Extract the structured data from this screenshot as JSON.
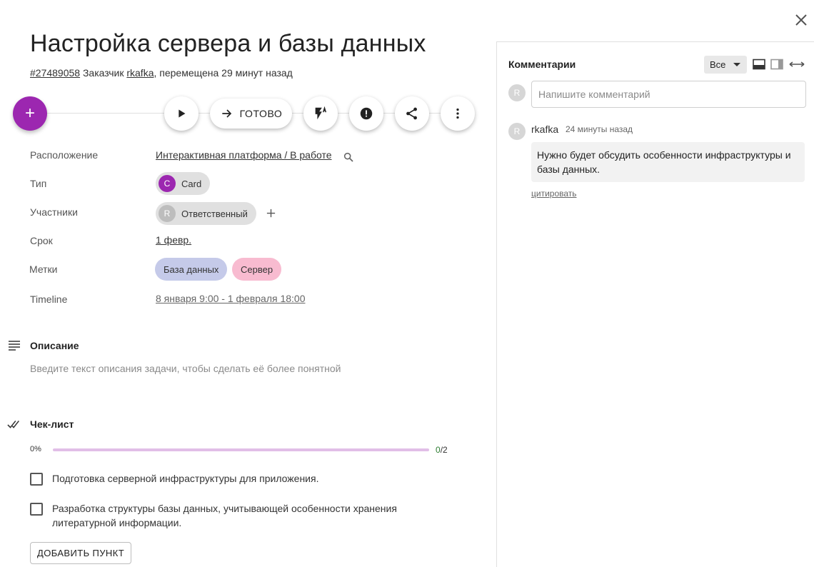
{
  "task": {
    "title": "Настройка сервера и базы данных",
    "id": "#27489058",
    "customer_prefix": "Заказчик",
    "customer": "rkafka",
    "moved_text": ", перемещена 29 минут назад"
  },
  "toolbar": {
    "add_label": "+",
    "done_label": "ГОТОВО"
  },
  "fields": {
    "location_label": "Расположение",
    "location_value": "Интерактивная платформа / В работе",
    "type_label": "Тип",
    "type_avatar": "C",
    "type_value": "Card",
    "participants_label": "Участники",
    "participant_avatar": "R",
    "participant_value": "Ответственный",
    "due_label": "Срок",
    "due_value": "1 февр.",
    "tags_label": "Метки",
    "tags": [
      {
        "label": "База данных",
        "color": "#c5cae9"
      },
      {
        "label": "Сервер",
        "color": "#f8bbd0"
      }
    ],
    "timeline_label": "Timeline",
    "timeline_value": "8 января 9:00 - 1 февраля 18:00"
  },
  "description": {
    "title": "Описание",
    "placeholder": "Введите текст описания задачи, чтобы сделать её более понятной"
  },
  "checklist": {
    "title": "Чек-лист",
    "percent": "0%",
    "done": "0",
    "total": "/2",
    "progress": 0,
    "items": [
      {
        "text": "Подготовка серверной инфраструктуры для приложения.",
        "checked": false
      },
      {
        "text": "Разработка структуры базы данных, учитывающей особенности хранения литературной информации.",
        "checked": false
      }
    ],
    "add_label": "ДОБАВИТЬ ПУНКТ"
  },
  "comments": {
    "title": "Комментарии",
    "filter_value": "Все",
    "input_avatar": "R",
    "input_placeholder": "Напишите комментарий",
    "items": [
      {
        "avatar": "R",
        "author": "rkafka",
        "time": "24 минуты назад",
        "text": "Нужно будет обсудить особенности инфраструктуры и базы данных.",
        "quote_label": "цитировать"
      }
    ]
  },
  "colors": {
    "accent": "#9c27b0",
    "type_avatar_bg": "#9c27b0",
    "participant_avatar_bg": "#bdbdbd"
  }
}
